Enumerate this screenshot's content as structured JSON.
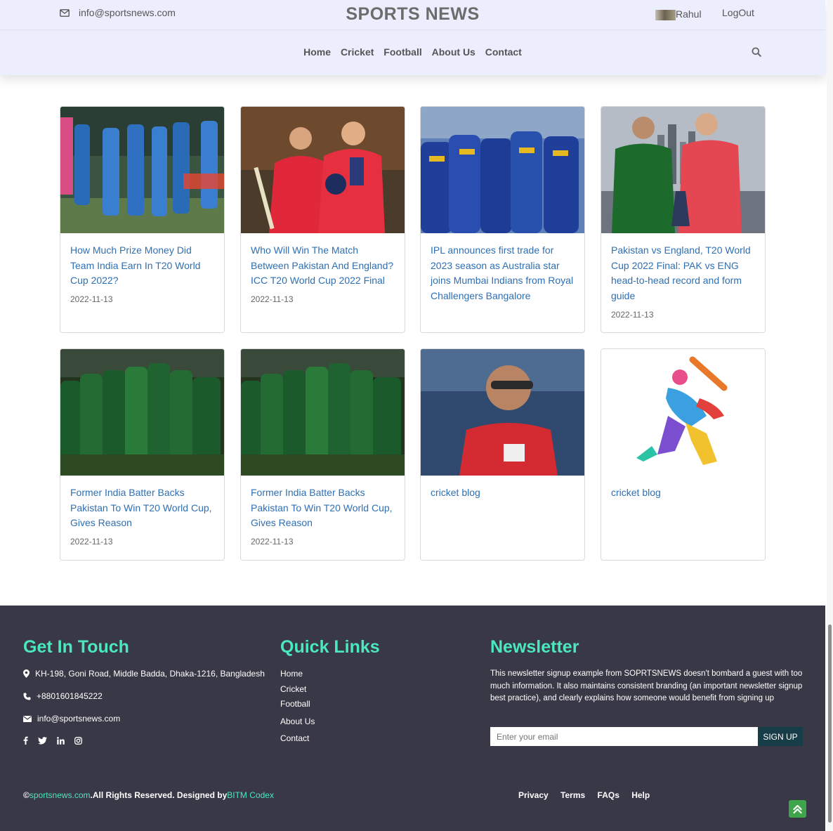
{
  "header": {
    "email": "info@sportsnews.com",
    "brand": "SPORTS NEWS",
    "user_name": "Rahul",
    "logout": "LogOut",
    "nav": [
      "Home",
      "Cricket",
      "Football",
      "About Us",
      "Contact"
    ]
  },
  "posts": [
    {
      "title": "How Much Prize Money Did Team India Earn In T20 World Cup 2022?",
      "date": "2022-11-13"
    },
    {
      "title": "Who Will Win The Match Between Pakistan And England? ICC T20 World Cup 2022 Final",
      "date": "2022-11-13"
    },
    {
      "title": "IPL announces first trade for 2023 season as Australia star joins Mumbai Indians from Royal Challengers Bangalore",
      "date": ""
    },
    {
      "title": "Pakistan vs England, T20 World Cup 2022 Final: PAK vs ENG head-to-head record and form guide",
      "date": "2022-11-13"
    },
    {
      "title": "Former India Batter Backs Pakistan To Win T20 World Cup, Gives Reason",
      "date": "2022-11-13"
    },
    {
      "title": "Former India Batter Backs Pakistan To Win T20 World Cup, Gives Reason",
      "date": "2022-11-13"
    },
    {
      "title": "cricket blog",
      "date": ""
    },
    {
      "title": "cricket blog",
      "date": ""
    }
  ],
  "footer": {
    "get_in_touch": {
      "heading": "Get In Touch",
      "address": "KH-198, Goni Road, Middle Badda, Dhaka-1216, Bangladesh",
      "phone": "+8801601845222",
      "email": "info@sportsnews.com"
    },
    "quick_links": {
      "heading": "Quick Links",
      "items": [
        "Home",
        "Cricket",
        "Football",
        "About Us",
        "Contact"
      ]
    },
    "newsletter": {
      "heading": "Newsletter",
      "text": "This newsletter signup example from SOPRTSNEWS doesn't bombard a guest with too much information. It also maintains consistent branding (an important newsletter signup best practice), and clearly explains how someone would benefit from signing up",
      "placeholder": "Enter your email",
      "button": "SIGN UP"
    },
    "copyright": {
      "symbol": "©",
      "site": "sportsnews.com",
      "text": ".All Rights Reserved. Designed by",
      "designer": "BITM Codex"
    },
    "links": [
      "Privacy",
      "Terms",
      "FAQs",
      "Help"
    ]
  },
  "colors": {
    "header_bg": "#eceefd",
    "link_blue": "#2f6fb3",
    "footer_bg": "#393846",
    "footer_accent": "#4be7bf",
    "signup_bg": "#173d48",
    "to_top_bg": "#3fa54b"
  },
  "icons": {
    "email": "envelope-icon",
    "search": "search-icon",
    "location": "map-marker-icon",
    "phone": "phone-icon",
    "social": [
      "facebook-icon",
      "twitter-icon",
      "linkedin-icon",
      "instagram-icon"
    ],
    "to_top": "double-chevron-up-icon"
  }
}
